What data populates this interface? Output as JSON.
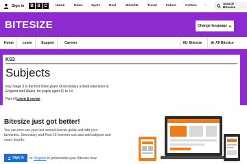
{
  "global_bar": {
    "signin_label": "Sign in",
    "nav": [
      "Home",
      "News",
      "Sport",
      "Reel",
      "Worklife",
      "Travel",
      "Future",
      "Culture",
      "···"
    ],
    "search_label": "Search Bitesize"
  },
  "header": {
    "logo": "BITESIZE",
    "change_language": "Change language"
  },
  "local_nav": {
    "items": [
      "Home",
      "Learn",
      "Support",
      "Careers"
    ],
    "my_bitesize": "My Bitesize",
    "all_bitesize": "All Bitesize"
  },
  "page": {
    "stage": "KS3",
    "title": "Subjects",
    "description": "Key Stage 3 is the first three years of secondary school education in England and Wales, for pupils aged 11 to 14.",
    "part_of_prefix": "Part of",
    "part_of_link": "Learn & revise"
  },
  "promo": {
    "title": "Bitesize just got better!",
    "text": "You can now see your last viewed learner guide and add your favourites. Secondary and Post-16 learners can also add subjects and exam boards.",
    "signin_button": "Sign in",
    "or_text": "or",
    "register_link": "Register",
    "register_suffix": "to personalise your Bitesize now."
  },
  "colors": {
    "brand_purple": "#8d2bd0",
    "signin_blue": "#1e6bd6",
    "illustration_orange": "#f07c1a"
  }
}
